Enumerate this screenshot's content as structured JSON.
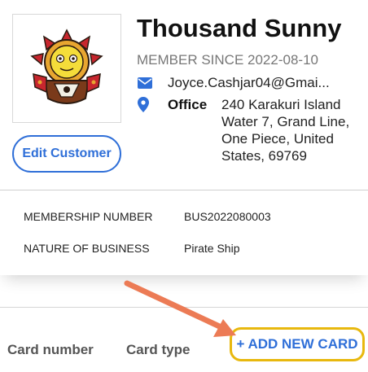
{
  "customer": {
    "name": "Thousand Sunny",
    "member_since": "MEMBER SINCE 2022-08-10",
    "email": "Joyce.Cashjar04@Gmai...",
    "address_label": "Office",
    "address_lines": [
      "240 Karakuri Island",
      "Water 7, Grand Line,",
      "One Piece, United",
      "States, 69769"
    ],
    "avatar_icon": "thousand-sunny-logo"
  },
  "actions": {
    "edit_label": "Edit Customer",
    "add_card_label": "+ ADD NEW CARD"
  },
  "details": [
    {
      "label": "MEMBERSHIP NUMBER",
      "value": "BUS2022080003"
    },
    {
      "label": "NATURE OF BUSINESS",
      "value": "Pirate Ship"
    }
  ],
  "cards_table": {
    "columns": [
      "Card number",
      "Card type"
    ]
  },
  "colors": {
    "accent": "#2f6fd8",
    "highlight": "#e8b80e",
    "annotation_arrow": "#ec7b55"
  }
}
